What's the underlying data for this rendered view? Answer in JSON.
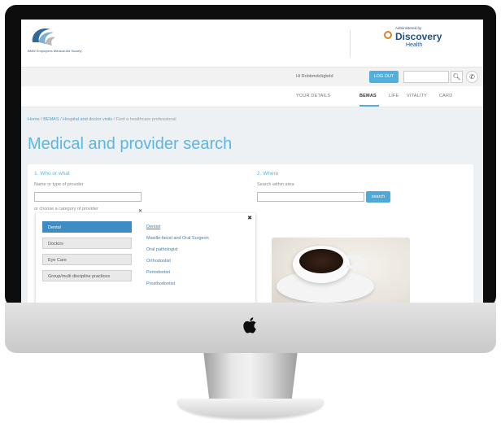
{
  "header": {
    "brand_text": "BMW Employees Medical Aid Society",
    "admin_label": "Administered by",
    "admin_brand": "Discovery",
    "admin_brand_sub": "Health"
  },
  "user_bar": {
    "greeting": "Hi Robbmdcbgbdd",
    "logout_label": "LOG OUT"
  },
  "nav": {
    "items": [
      "YOUR DETAILS",
      "BEMAS",
      "LIFE",
      "VITALITY",
      "CARD"
    ],
    "active": "BEMAS"
  },
  "breadcrumb": [
    "Home",
    "BEMAS",
    "Hospital and doctor visits",
    "Find a healthcare professional"
  ],
  "page_title": "Medical and provider search",
  "who": {
    "heading": "1. Who or what",
    "label": "Name or type of provider",
    "or_text": "or choose a category of provider"
  },
  "where": {
    "heading": "2. Where",
    "label": "Search within area",
    "button": "search"
  },
  "categories": [
    "Dental",
    "Doctors",
    "Eye Care",
    "Group/multi discipline practices"
  ],
  "active_category": "Dental",
  "subcategories": [
    "Dentist",
    "Maxillo-facial and Oral Surgeon",
    "Oral pathologist",
    "Orthodontist",
    "Periodontist",
    "Prosthodontist"
  ],
  "colors": {
    "accent": "#5bb6e0",
    "active_category": "#3e8cc4",
    "brand": "#1c4f8a"
  }
}
